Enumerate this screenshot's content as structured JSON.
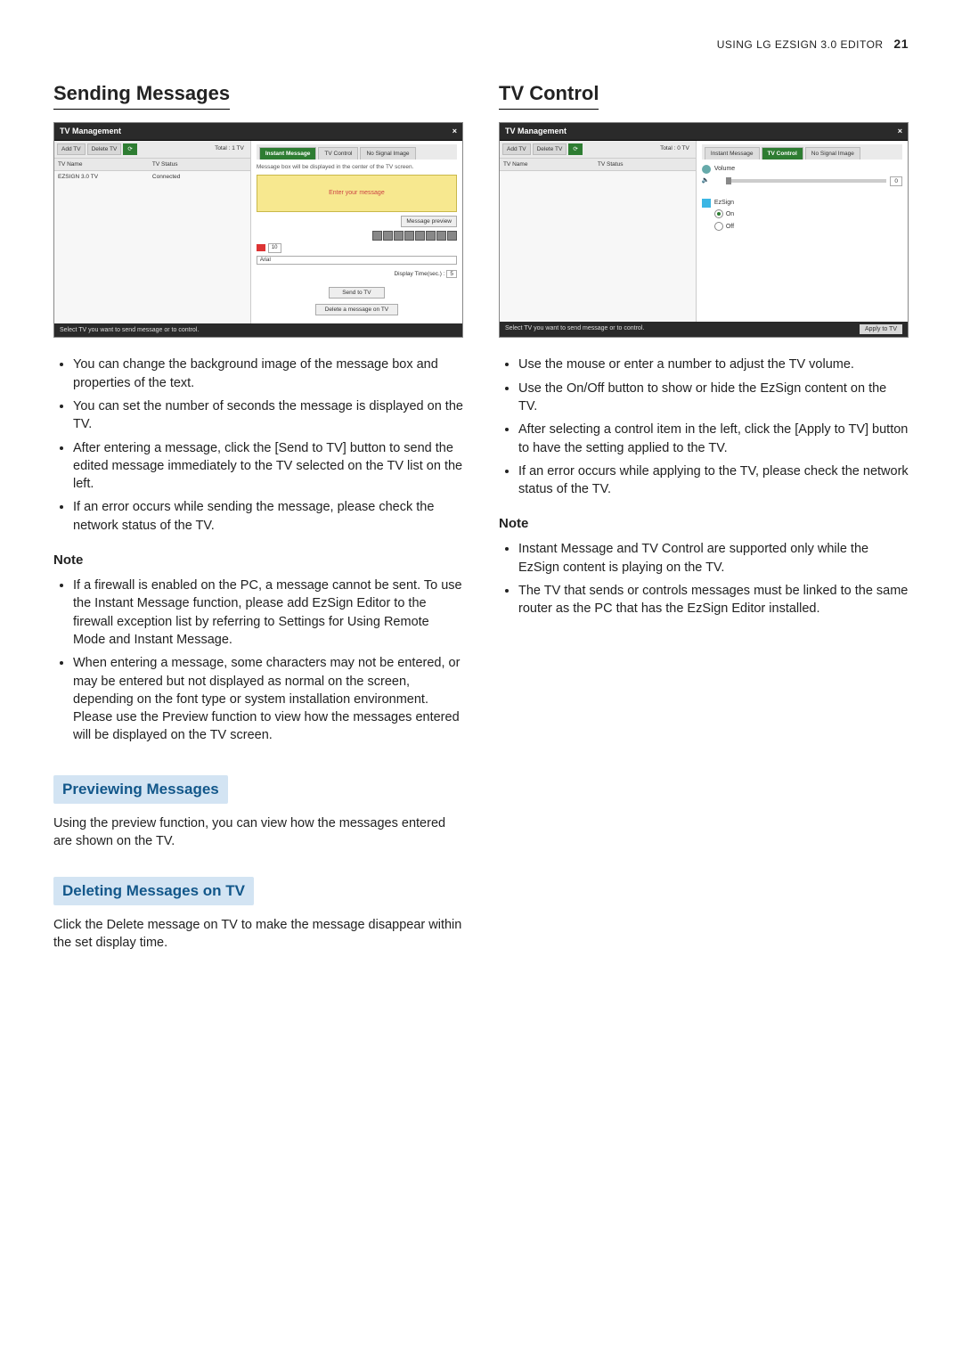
{
  "header": {
    "section": "USING LG EZSIGN 3.0 EDITOR",
    "page": "21"
  },
  "left": {
    "title": "Sending Messages",
    "screenshot1": {
      "win_title": "TV Management",
      "close": "×",
      "toolbar": {
        "add": "Add TV",
        "del": "Delete TV",
        "refresh": "⟳",
        "total": "Total : 1 TV"
      },
      "tv_header": {
        "name": "TV Name",
        "status": "TV Status"
      },
      "tv_row": {
        "name": "EZSIGN 3.0 TV",
        "status": "Connected"
      },
      "tabs": {
        "im": "Instant Message",
        "tvc": "TV Control",
        "nsi": "No Signal Image"
      },
      "hint": "Message box will be displayed in the center of the TV screen.",
      "msg_placeholder": "Enter your message",
      "preview_btn": "Message preview",
      "font_select": "Arial",
      "font_size": "10",
      "dt_label": "Display Time(sec.) :",
      "dt_val": "5",
      "send_btn": "Send to TV",
      "delete_btn": "Delete a message on TV",
      "footer_hint": "Select TV you want to send message or to control."
    },
    "bullets1": [
      "You can change the background image of the message box and properties of the text.",
      "You can set the number of seconds the message is displayed on the TV.",
      "After entering a message, click the [Send to TV] button to send the edited message immediately to the TV selected on the TV list on the left.",
      "If an error occurs while sending the message, please check the network status of the TV."
    ],
    "note_label": "Note",
    "note_bullets": [
      "If a firewall is enabled on the PC, a message cannot be sent. To use the Instant Message function, please add EzSign Editor to the firewall exception list by referring to Settings for Using Remote Mode and Instant Message.",
      "When entering a message, some characters may not be entered, or may be entered but not displayed as normal on the screen, depending on the font type or system installation environment. Please use the Preview function to view how the messages entered will be displayed on the TV screen."
    ],
    "sub1_title": "Previewing Messages",
    "sub1_body": "Using the preview function, you can view how the messages entered are shown on the TV.",
    "sub2_title": "Deleting Messages on TV",
    "sub2_body": "Click the Delete message on TV to make the message disappear within the set display time."
  },
  "right": {
    "title": "TV Control",
    "screenshot2": {
      "win_title": "TV Management",
      "close": "×",
      "toolbar": {
        "add": "Add TV",
        "del": "Delete TV",
        "refresh": "⟳",
        "total": "Total : 0 TV"
      },
      "tv_header": {
        "name": "TV Name",
        "status": "TV Status"
      },
      "tabs": {
        "im": "Instant Message",
        "tvc": "TV Control",
        "nsi": "No Signal Image"
      },
      "vol_label": "Volume",
      "vol_val": "0",
      "ezsign_label": "EzSign",
      "on": "On",
      "off": "Off",
      "apply_btn": "Apply to TV",
      "footer_hint": "Select TV you want to send message or to control."
    },
    "bullets1": [
      "Use the mouse or enter a number to adjust the TV volume.",
      "Use the On/Off button to show or hide the EzSign content on the TV.",
      "After selecting a control item in the left, click the [Apply to TV] button to have the setting applied to the TV.",
      "If an error occurs while applying to the TV, please check the network status of the TV."
    ],
    "note_label": "Note",
    "note_bullets": [
      "Instant Message and TV Control are supported only while the EzSign content is playing on the TV.",
      "The TV that sends or controls messages must be linked to the same router as the PC that has the EzSign Editor installed."
    ]
  }
}
